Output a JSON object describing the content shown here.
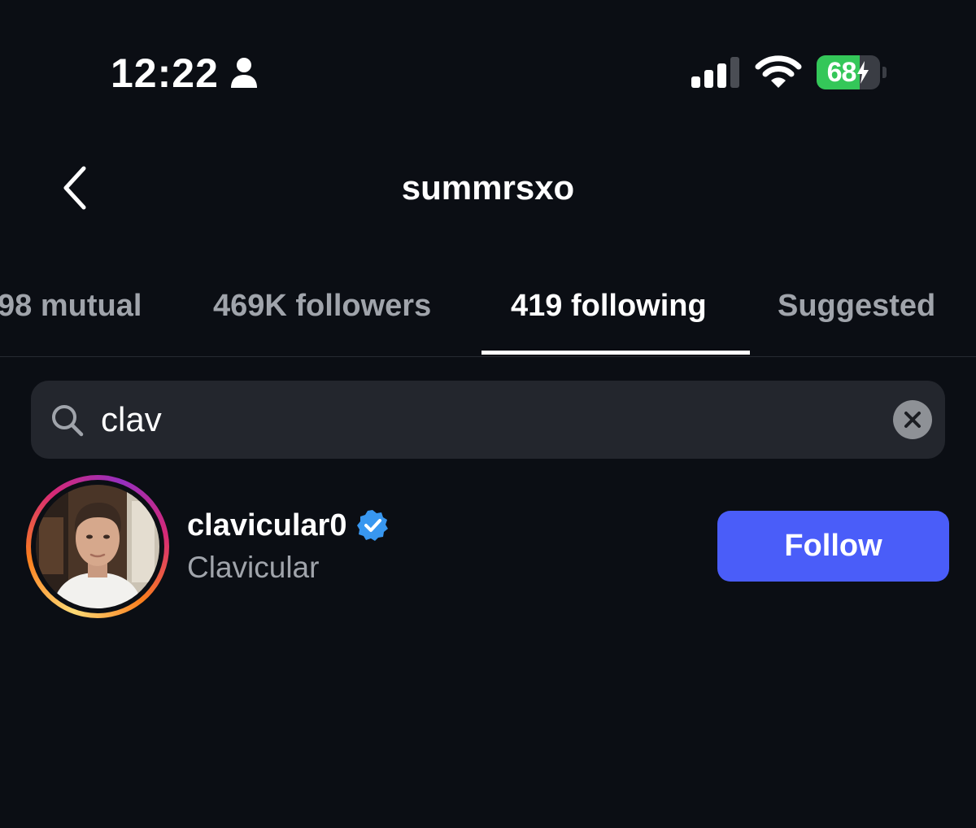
{
  "status_bar": {
    "time": "12:22",
    "battery_percent": "68",
    "battery_level": 0.68,
    "icons": [
      "person-icon",
      "signal-icon",
      "wifi-icon",
      "battery-icon",
      "charging-bolt-icon"
    ]
  },
  "header": {
    "title": "summrsxo",
    "back_icon": "chevron-left-icon"
  },
  "tabs": [
    {
      "label": "98 mutual",
      "active": false
    },
    {
      "label": "469K followers",
      "active": false
    },
    {
      "label": "419 following",
      "active": true
    },
    {
      "label": "Suggested",
      "active": false
    }
  ],
  "search": {
    "value": "clav",
    "icon": "search-icon",
    "clear_icon": "close-icon"
  },
  "results": [
    {
      "username": "clavicular0",
      "full_name": "Clavicular",
      "verified": true,
      "story_ring": true,
      "follow_label": "Follow"
    }
  ],
  "colors": {
    "background": "#0b0e14",
    "follow_button": "#4a5df9",
    "verified_badge": "#3897f0",
    "battery_fill": "#34c759",
    "muted_text": "#a0a4ab",
    "search_bg": "#23262d"
  }
}
